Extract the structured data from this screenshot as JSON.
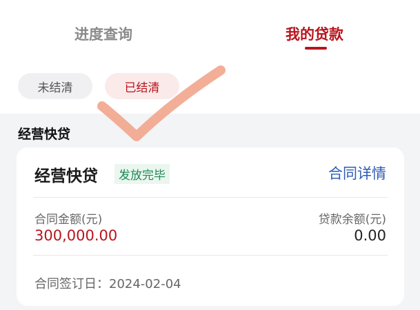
{
  "tabs": [
    {
      "label": "进度查询",
      "active": false
    },
    {
      "label": "我的贷款",
      "active": true
    }
  ],
  "filters": [
    {
      "label": "未结清",
      "selected": false
    },
    {
      "label": "已结清",
      "selected": true
    }
  ],
  "section": {
    "title": "经营快贷"
  },
  "loan": {
    "name": "经营快贷",
    "status": "发放完毕",
    "details_link": "合同详情",
    "contract_amount_label": "合同金额(元)",
    "contract_amount": "300,000.00",
    "balance_label": "贷款余额(元)",
    "balance": "0.00",
    "sign_date_text": "合同签订日：2024-02-04"
  },
  "colors": {
    "accent": "#b8141c",
    "link": "#2f5bb5",
    "status_green": "#1e8a56",
    "checkmark": "#f2a58d"
  }
}
